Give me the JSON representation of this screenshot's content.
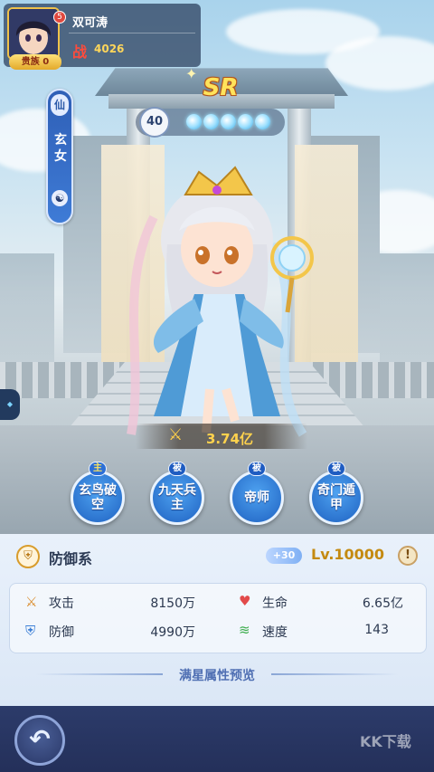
{
  "player": {
    "name": "双可涛",
    "power_icon": "战",
    "power": "4026",
    "noble_label": "贵族 0",
    "avatar_badge": "5"
  },
  "hero": {
    "category_tag": "仙",
    "name_vertical": "玄女",
    "element_icon": "yin-yang-icon",
    "rarity": "SR",
    "level": "40",
    "awaken_stars": 5,
    "battle_power": "3.74亿",
    "role_label": "防御系",
    "level_bonus": "+30",
    "level_text": "Lv.10000"
  },
  "skills": [
    {
      "tag": "主",
      "label": "玄鸟破空",
      "main": true
    },
    {
      "tag": "被",
      "label": "九天兵主",
      "main": false
    },
    {
      "tag": "被",
      "label": "帝师",
      "main": false
    },
    {
      "tag": "被",
      "label": "奇门遁甲",
      "main": false
    }
  ],
  "stats": [
    {
      "icon": "sword-icon",
      "label": "攻击",
      "value": "8150万"
    },
    {
      "icon": "heart-icon",
      "label": "生命",
      "value": "6.65亿"
    },
    {
      "icon": "shield-icon",
      "label": "防御",
      "value": "4990万"
    },
    {
      "icon": "speed-icon",
      "label": "速度",
      "value": "143"
    }
  ],
  "preview_label": "满星属性预览",
  "watermark": "KK下载",
  "colors": {
    "gold": "#ffd24d",
    "skill_blue": "#1f62c2",
    "panel_bg": "#e9f1fb",
    "bottom_bar": "#2c3b6a"
  }
}
